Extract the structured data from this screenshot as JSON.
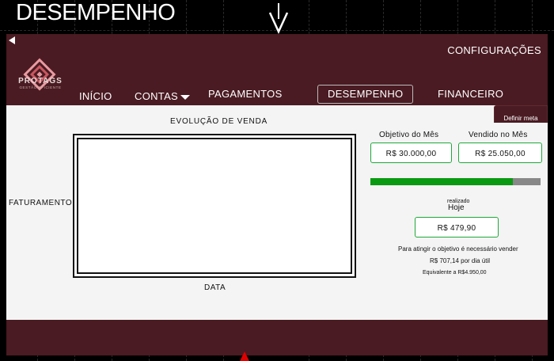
{
  "frame": {
    "title": "DESEMPENHO"
  },
  "logo": {
    "name": "PROTAGS",
    "tagline": "GESTÃO EFICIENTE"
  },
  "header": {
    "settings_label": "CONFIGURAÇÕES",
    "nav": {
      "inicio": "INÍCIO",
      "contas": "CONTAS",
      "pagamentos": "PAGAMENTOS",
      "desempenho": "DESEMPENHO",
      "financeiro": "FINANCEIRO"
    }
  },
  "actions": {
    "define_goal": "Definir meta"
  },
  "chart": {
    "title": "EVOLUÇÃO DE VENDA",
    "ylabel": "FATURAMENTO",
    "xlabel": "DATA"
  },
  "chart_data": {
    "type": "line",
    "title": "EVOLUÇÃO DE VENDA",
    "xlabel": "DATA",
    "ylabel": "FATURAMENTO",
    "series": []
  },
  "kpis": {
    "goal_label": "Objetivo do Mês",
    "goal_value": "R$ 30.000,00",
    "sold_label": "Vendido no Mês",
    "sold_value": "R$ 25.050,00",
    "progress_fraction": 0.835,
    "progress_color": "#0a9a12",
    "realized_label": "realizado",
    "today_label": "Hoje",
    "today_value": "R$ 479,90"
  },
  "message": {
    "line1": "Para atingir o objetivo é necessário vender",
    "line2": "R$ 707,14 por dia útil",
    "line3": "Equivalente a  R$4.950,00"
  },
  "colors": {
    "brand": "#4a1b22",
    "accent": "#1fa83a",
    "marker": "#e00000"
  }
}
